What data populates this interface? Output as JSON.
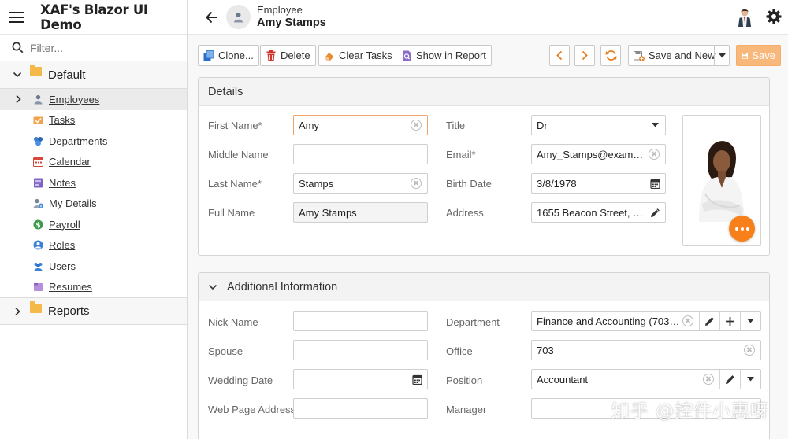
{
  "app": {
    "title": "XAF's Blazor UI Demo"
  },
  "sidebar": {
    "filter_placeholder": "Filter...",
    "group_default": "Default",
    "items": [
      {
        "label": "Employees",
        "icon": "employee-icon",
        "active": true
      },
      {
        "label": "Tasks",
        "icon": "tasks-icon"
      },
      {
        "label": "Departments",
        "icon": "departments-icon"
      },
      {
        "label": "Calendar",
        "icon": "calendar-icon"
      },
      {
        "label": "Notes",
        "icon": "notes-icon"
      },
      {
        "label": "My Details",
        "icon": "my-details-icon"
      },
      {
        "label": "Payroll",
        "icon": "payroll-icon"
      },
      {
        "label": "Roles",
        "icon": "roles-icon"
      },
      {
        "label": "Users",
        "icon": "users-icon"
      },
      {
        "label": "Resumes",
        "icon": "resumes-icon"
      }
    ],
    "group_reports": "Reports"
  },
  "header": {
    "object_type": "Employee",
    "object_name": "Amy Stamps"
  },
  "toolbar": {
    "clone": "Clone...",
    "delete": "Delete",
    "clear_tasks": "Clear Tasks",
    "show_in_report": "Show in Report",
    "save_and_new": "Save and New",
    "save": "Save"
  },
  "details": {
    "title": "Details",
    "first_name_label": "First Name*",
    "first_name": "Amy",
    "middle_name_label": "Middle Name",
    "middle_name": "",
    "last_name_label": "Last Name*",
    "last_name": "Stamps",
    "full_name_label": "Full Name",
    "full_name": "Amy Stamps",
    "title_label": "Title",
    "title_value": "Dr",
    "email_label": "Email*",
    "email": "Amy_Stamps@exampl...",
    "birth_date_label": "Birth Date",
    "birth_date": "3/8/1978",
    "address_label": "Address",
    "address": "1655 Beacon Street, O..."
  },
  "additional": {
    "title": "Additional Information",
    "nick_name_label": "Nick Name",
    "nick_name": "",
    "spouse_label": "Spouse",
    "spouse": "",
    "wedding_date_label": "Wedding Date",
    "wedding_date": "",
    "web_page_label": "Web Page Address",
    "web_page": "",
    "department_label": "Department",
    "department": "Finance and Accounting (703, ...",
    "office_label": "Office",
    "office": "703",
    "position_label": "Position",
    "position": "Accountant",
    "manager_label": "Manager",
    "manager": ""
  },
  "watermark": "知乎 @控件小惠呀",
  "colors": {
    "accent": "#f8801b",
    "save_disabled": "#f8b77b",
    "link_blue": "#2a6fc9"
  }
}
